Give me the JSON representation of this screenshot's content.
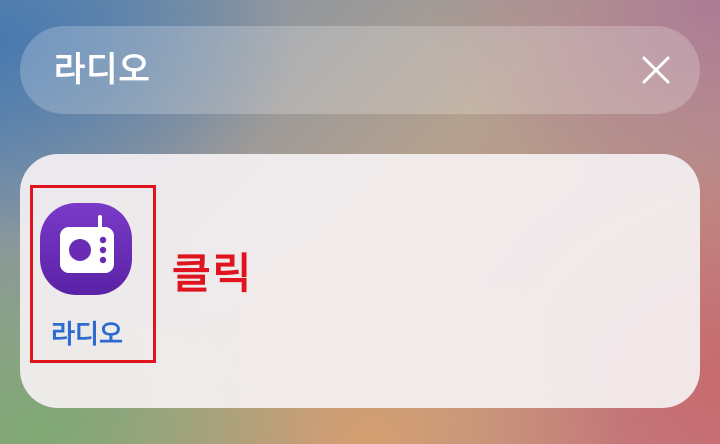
{
  "search": {
    "query": "라디오",
    "clear_icon": "close-icon"
  },
  "results": [
    {
      "label": "라디오",
      "icon": "radio-app-icon",
      "icon_color": "#6a2bb5",
      "label_color": "#2e6bd1"
    }
  ],
  "annotation": {
    "text": "클릭",
    "color": "#e0141e"
  }
}
